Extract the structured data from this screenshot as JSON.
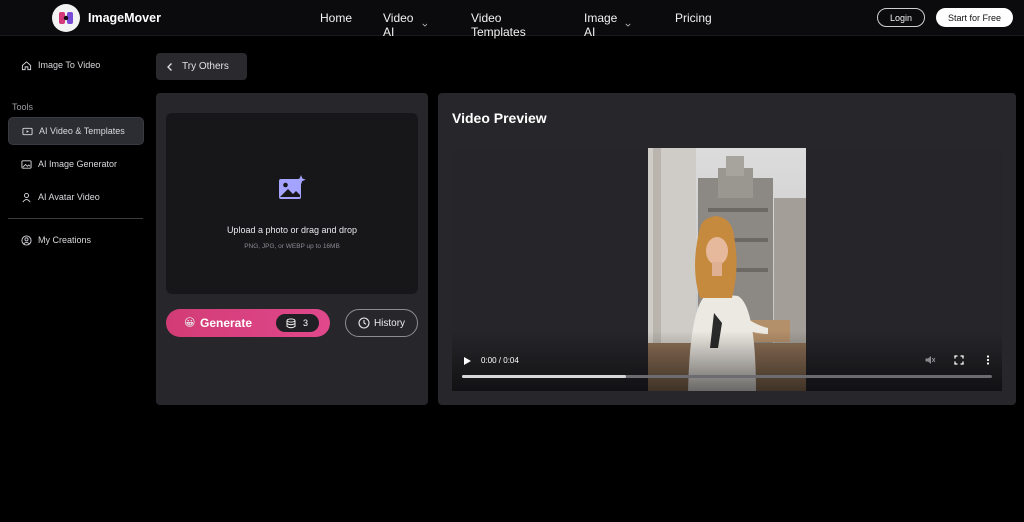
{
  "brand": {
    "name": "ImageMover"
  },
  "nav": {
    "items": [
      {
        "label": "Home",
        "has_dropdown": false
      },
      {
        "label": "Video AI",
        "has_dropdown": true
      },
      {
        "label": "Video Templates",
        "has_dropdown": false
      },
      {
        "label": "Image AI",
        "has_dropdown": true
      },
      {
        "label": "Pricing",
        "has_dropdown": false
      }
    ],
    "login_label": "Login",
    "start_label": "Start for Free"
  },
  "sidebar": {
    "top_item": {
      "label": "Image To Video",
      "icon": "home-icon"
    },
    "section_label": "Tools",
    "tools": [
      {
        "label": "AI Video & Templates",
        "icon": "video-icon",
        "active": true
      },
      {
        "label": "AI Image Generator",
        "icon": "image-icon",
        "active": false
      },
      {
        "label": "AI Avatar Video",
        "icon": "avatar-icon",
        "active": false
      }
    ],
    "creations_label": "My Creations"
  },
  "back_button": {
    "label": "Try Others"
  },
  "upload": {
    "title": "Upload a photo or drag and drop",
    "subtitle": "PNG, JPG, or WEBP up to 16MB"
  },
  "generate": {
    "label": "Generate",
    "credits": "3"
  },
  "history": {
    "label": "History"
  },
  "preview": {
    "title": "Video Preview",
    "time": "0:00 / 0:04",
    "progress": 0.31
  },
  "colors": {
    "accent_pink": "#d23c75",
    "panel_bg": "#27272b",
    "upload_icon": "#9c9cff"
  }
}
